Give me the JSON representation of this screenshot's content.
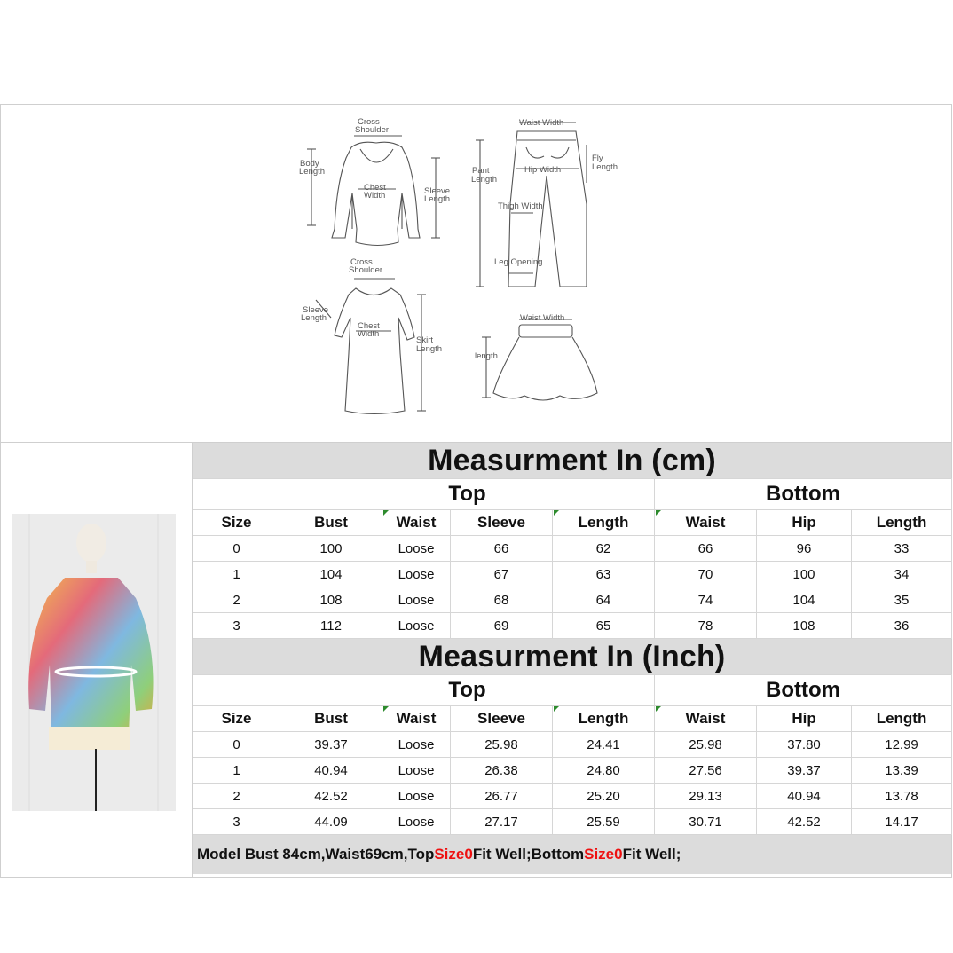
{
  "diagrams": {
    "top": {
      "cross_shoulder": [
        "Cross",
        "Shoulder"
      ],
      "body_length": [
        "Body",
        "Length"
      ],
      "chest_width": [
        "Chest",
        "Width"
      ],
      "sleeve_length": [
        "Sleeve",
        "Length"
      ]
    },
    "pants": {
      "waist_width": "Waist Width",
      "pant_length": [
        "Pant",
        "Length"
      ],
      "hip_width": "Hip Width",
      "fly_length": [
        "Fly",
        "Length"
      ],
      "thigh_width": "Thigh Width",
      "leg_opening": "Leg Opening"
    },
    "dress": {
      "cross_shoulder": [
        "Cross",
        "Shoulder"
      ],
      "sleeve_length": [
        "Sleeve",
        "Length"
      ],
      "chest_width": [
        "Chest",
        "Width"
      ],
      "skirt_length": [
        "Skirt",
        "Length"
      ]
    },
    "skirt": {
      "waist_width": "Waist Width",
      "length": "length"
    }
  },
  "cm_table": {
    "title": "Measurment In (cm)",
    "group_top": "Top",
    "group_bottom": "Bottom",
    "headers": [
      "Size",
      "Bust",
      "Waist",
      "Sleeve",
      "Length",
      "Waist",
      "Hip",
      "Length"
    ],
    "rows": [
      [
        "0",
        "100",
        "Loose",
        "66",
        "62",
        "66",
        "96",
        "33"
      ],
      [
        "1",
        "104",
        "Loose",
        "67",
        "63",
        "70",
        "100",
        "34"
      ],
      [
        "2",
        "108",
        "Loose",
        "68",
        "64",
        "74",
        "104",
        "35"
      ],
      [
        "3",
        "112",
        "Loose",
        "69",
        "65",
        "78",
        "108",
        "36"
      ]
    ]
  },
  "inch_table": {
    "title": "Measurment In (Inch)",
    "group_top": "Top",
    "group_bottom": "Bottom",
    "headers": [
      "Size",
      "Bust",
      "Waist",
      "Sleeve",
      "Length",
      "Waist",
      "Hip",
      "Length"
    ],
    "rows": [
      [
        "0",
        "39.37",
        "Loose",
        "25.98",
        "24.41",
        "25.98",
        "37.80",
        "12.99"
      ],
      [
        "1",
        "40.94",
        "Loose",
        "26.38",
        "24.80",
        "27.56",
        "39.37",
        "13.39"
      ],
      [
        "2",
        "42.52",
        "Loose",
        "26.77",
        "25.20",
        "29.13",
        "40.94",
        "13.78"
      ],
      [
        "3",
        "44.09",
        "Loose",
        "27.17",
        "25.59",
        "30.71",
        "42.52",
        "14.17"
      ]
    ]
  },
  "note": {
    "part1": "Model Bust 84cm,Waist69cm,Top ",
    "size_top": "Size0",
    "part2": " Fit Well;Bottom ",
    "size_bottom": "Size0",
    "part3": " Fit Well;"
  },
  "colors": {
    "band": "#dcdcdc",
    "highlight": "#e11111",
    "tick": "#2e8b2e"
  }
}
